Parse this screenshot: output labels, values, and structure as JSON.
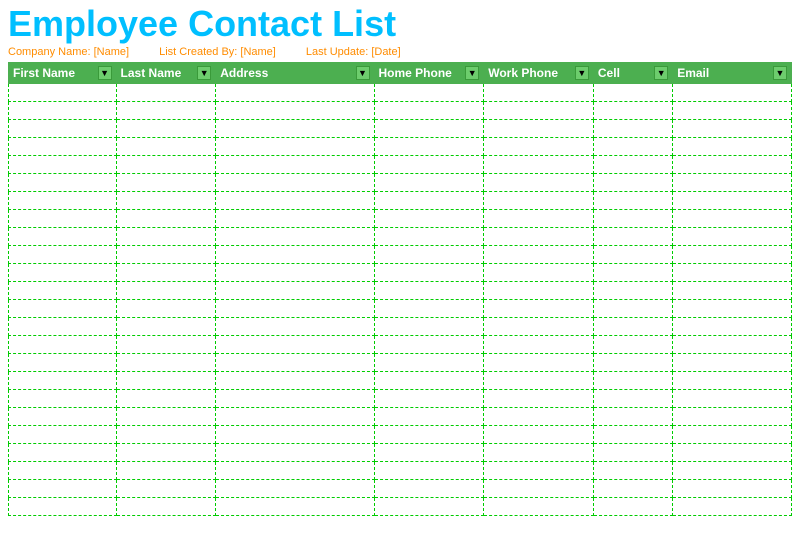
{
  "title": "Employee Contact List",
  "meta": {
    "company_label": "Company Name:",
    "company_value": "[Name]",
    "created_label": "List Created By:",
    "created_value": "[Name]",
    "updated_label": "Last Update:",
    "updated_value": "[Date]"
  },
  "columns": [
    {
      "label": "First Name",
      "key": "first-name"
    },
    {
      "label": "Last Name",
      "key": "last-name"
    },
    {
      "label": "Address",
      "key": "address"
    },
    {
      "label": "Home Phone",
      "key": "home-phone"
    },
    {
      "label": "Work Phone",
      "key": "work-phone"
    },
    {
      "label": "Cell",
      "key": "cell"
    },
    {
      "label": "Email",
      "key": "email"
    }
  ],
  "row_count": 24,
  "dropdown_symbol": "▼"
}
